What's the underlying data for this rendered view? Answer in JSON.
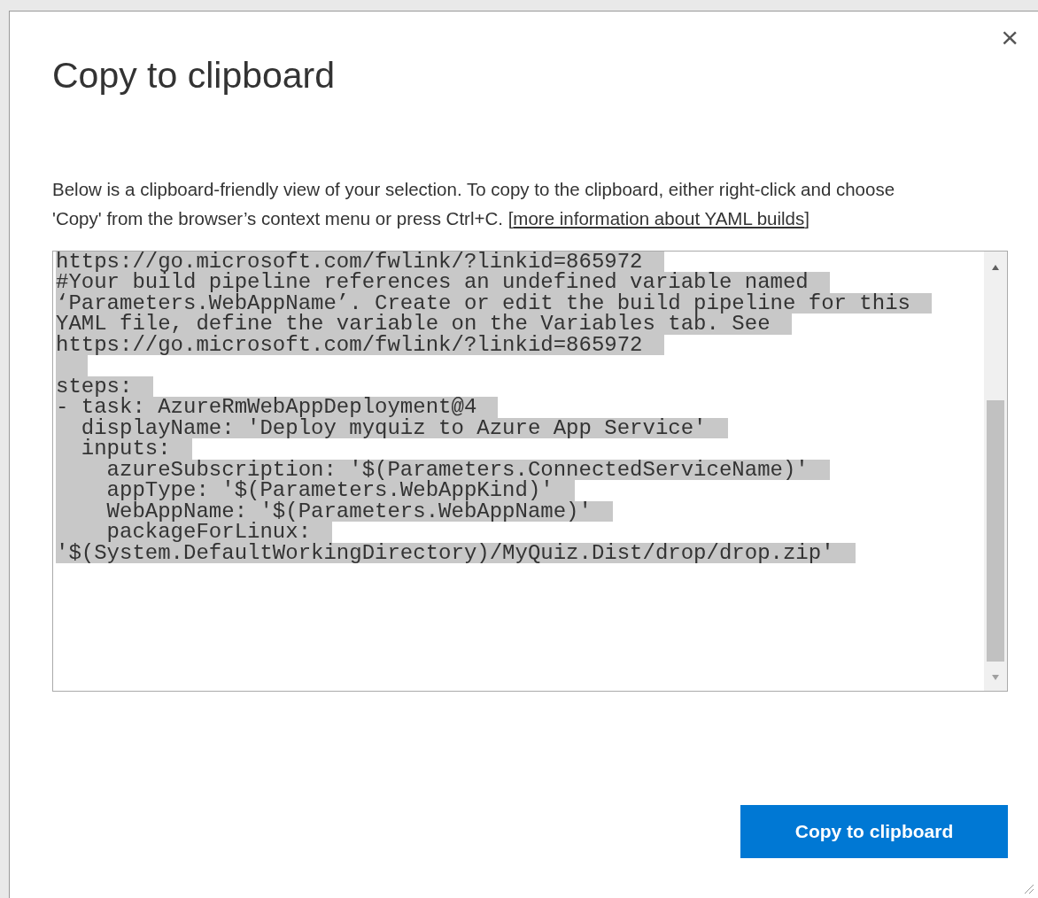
{
  "dialog": {
    "title": "Copy to clipboard",
    "close": "×",
    "description": {
      "text": "Below is a clipboard-friendly view of your selection. To copy to the clipboard, either right-click and choose 'Copy' from the browser’s context menu or press Ctrl+C.",
      "link_open": "[",
      "link": "more information about YAML builds",
      "link_close": "]"
    },
    "code": {
      "selected": true,
      "lines": [
        {
          "kind": "text",
          "text": "https://go.microsoft.com/fwlink/?linkid=865972"
        },
        {
          "kind": "text",
          "text": "#Your build pipeline references an undefined variable named"
        },
        {
          "kind": "text",
          "text": "‘Parameters.WebAppName’. Create or edit the build pipeline for this"
        },
        {
          "kind": "text",
          "text": "YAML file, define the variable on the Variables tab. See"
        },
        {
          "kind": "text",
          "text": "https://go.microsoft.com/fwlink/?linkid=865972"
        },
        {
          "kind": "blank"
        },
        {
          "kind": "text",
          "text": "steps:"
        },
        {
          "kind": "text",
          "text": "- task: AzureRmWebAppDeployment@4"
        },
        {
          "kind": "text",
          "text": "  displayName: 'Deploy myquiz to Azure App Service'"
        },
        {
          "kind": "text",
          "text": "  inputs:"
        },
        {
          "kind": "text",
          "text": "    azureSubscription: '$(Parameters.ConnectedServiceName)'"
        },
        {
          "kind": "text",
          "text": "    appType: '$(Parameters.WebAppKind)'"
        },
        {
          "kind": "text",
          "text": "    WebAppName: '$(Parameters.WebAppName)'"
        },
        {
          "kind": "text",
          "text": "    packageForLinux:"
        },
        {
          "kind": "text",
          "text": "'$(System.DefaultWorkingDirectory)/MyQuiz.Dist/drop/drop.zip'"
        }
      ]
    },
    "button": "Copy to clipboard"
  }
}
